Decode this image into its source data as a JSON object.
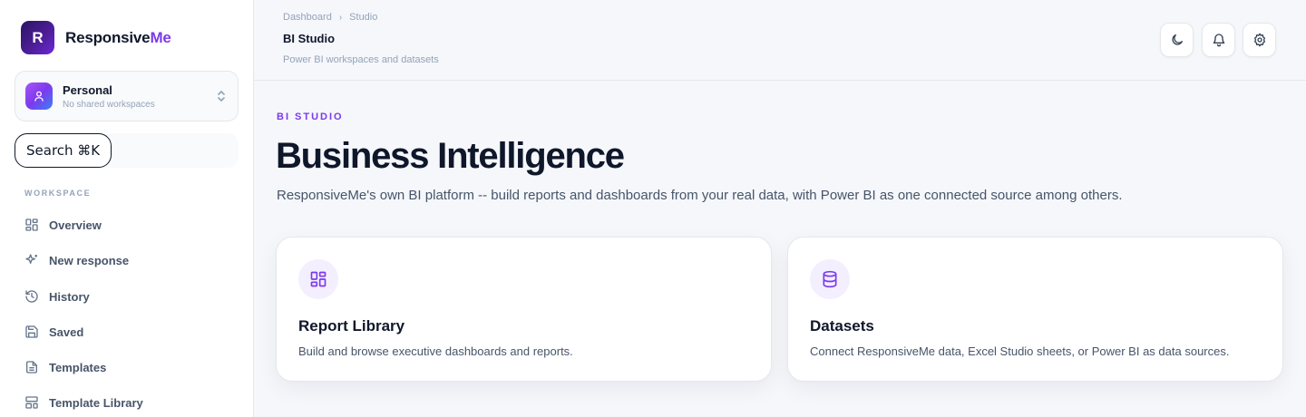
{
  "brand": {
    "logo_letter": "R",
    "name_main": "Responsive",
    "name_accent": "Me",
    "accent_color": "#7c3aed"
  },
  "workspace_switcher": {
    "title": "Personal",
    "subtitle": "No shared workspaces"
  },
  "search": {
    "label": "Search ⌘K"
  },
  "sidebar": {
    "heading": "WORKSPACE",
    "items": [
      {
        "label": "Overview",
        "icon": "grid-icon"
      },
      {
        "label": "New response",
        "icon": "sparkles-icon"
      },
      {
        "label": "History",
        "icon": "history-icon"
      },
      {
        "label": "Saved",
        "icon": "save-icon"
      },
      {
        "label": "Templates",
        "icon": "document-icon"
      },
      {
        "label": "Template Library",
        "icon": "layout-icon"
      }
    ]
  },
  "header": {
    "breadcrumb": [
      "Dashboard",
      "Studio"
    ],
    "title": "BI Studio",
    "subtitle": "Power BI workspaces and datasets",
    "actions": [
      "moon-icon",
      "bell-icon",
      "gear-icon"
    ]
  },
  "main": {
    "eyebrow": "BI STUDIO",
    "title": "Business Intelligence",
    "description": "ResponsiveMe's own BI platform -- build reports and dashboards from your real data, with Power BI as one connected source among others.",
    "cards": [
      {
        "title": "Report Library",
        "description": "Build and browse executive dashboards and reports.",
        "icon": "grid-icon"
      },
      {
        "title": "Datasets",
        "description": "Connect ResponsiveMe data, Excel Studio sheets, or Power BI as data sources.",
        "icon": "database-icon"
      }
    ]
  }
}
